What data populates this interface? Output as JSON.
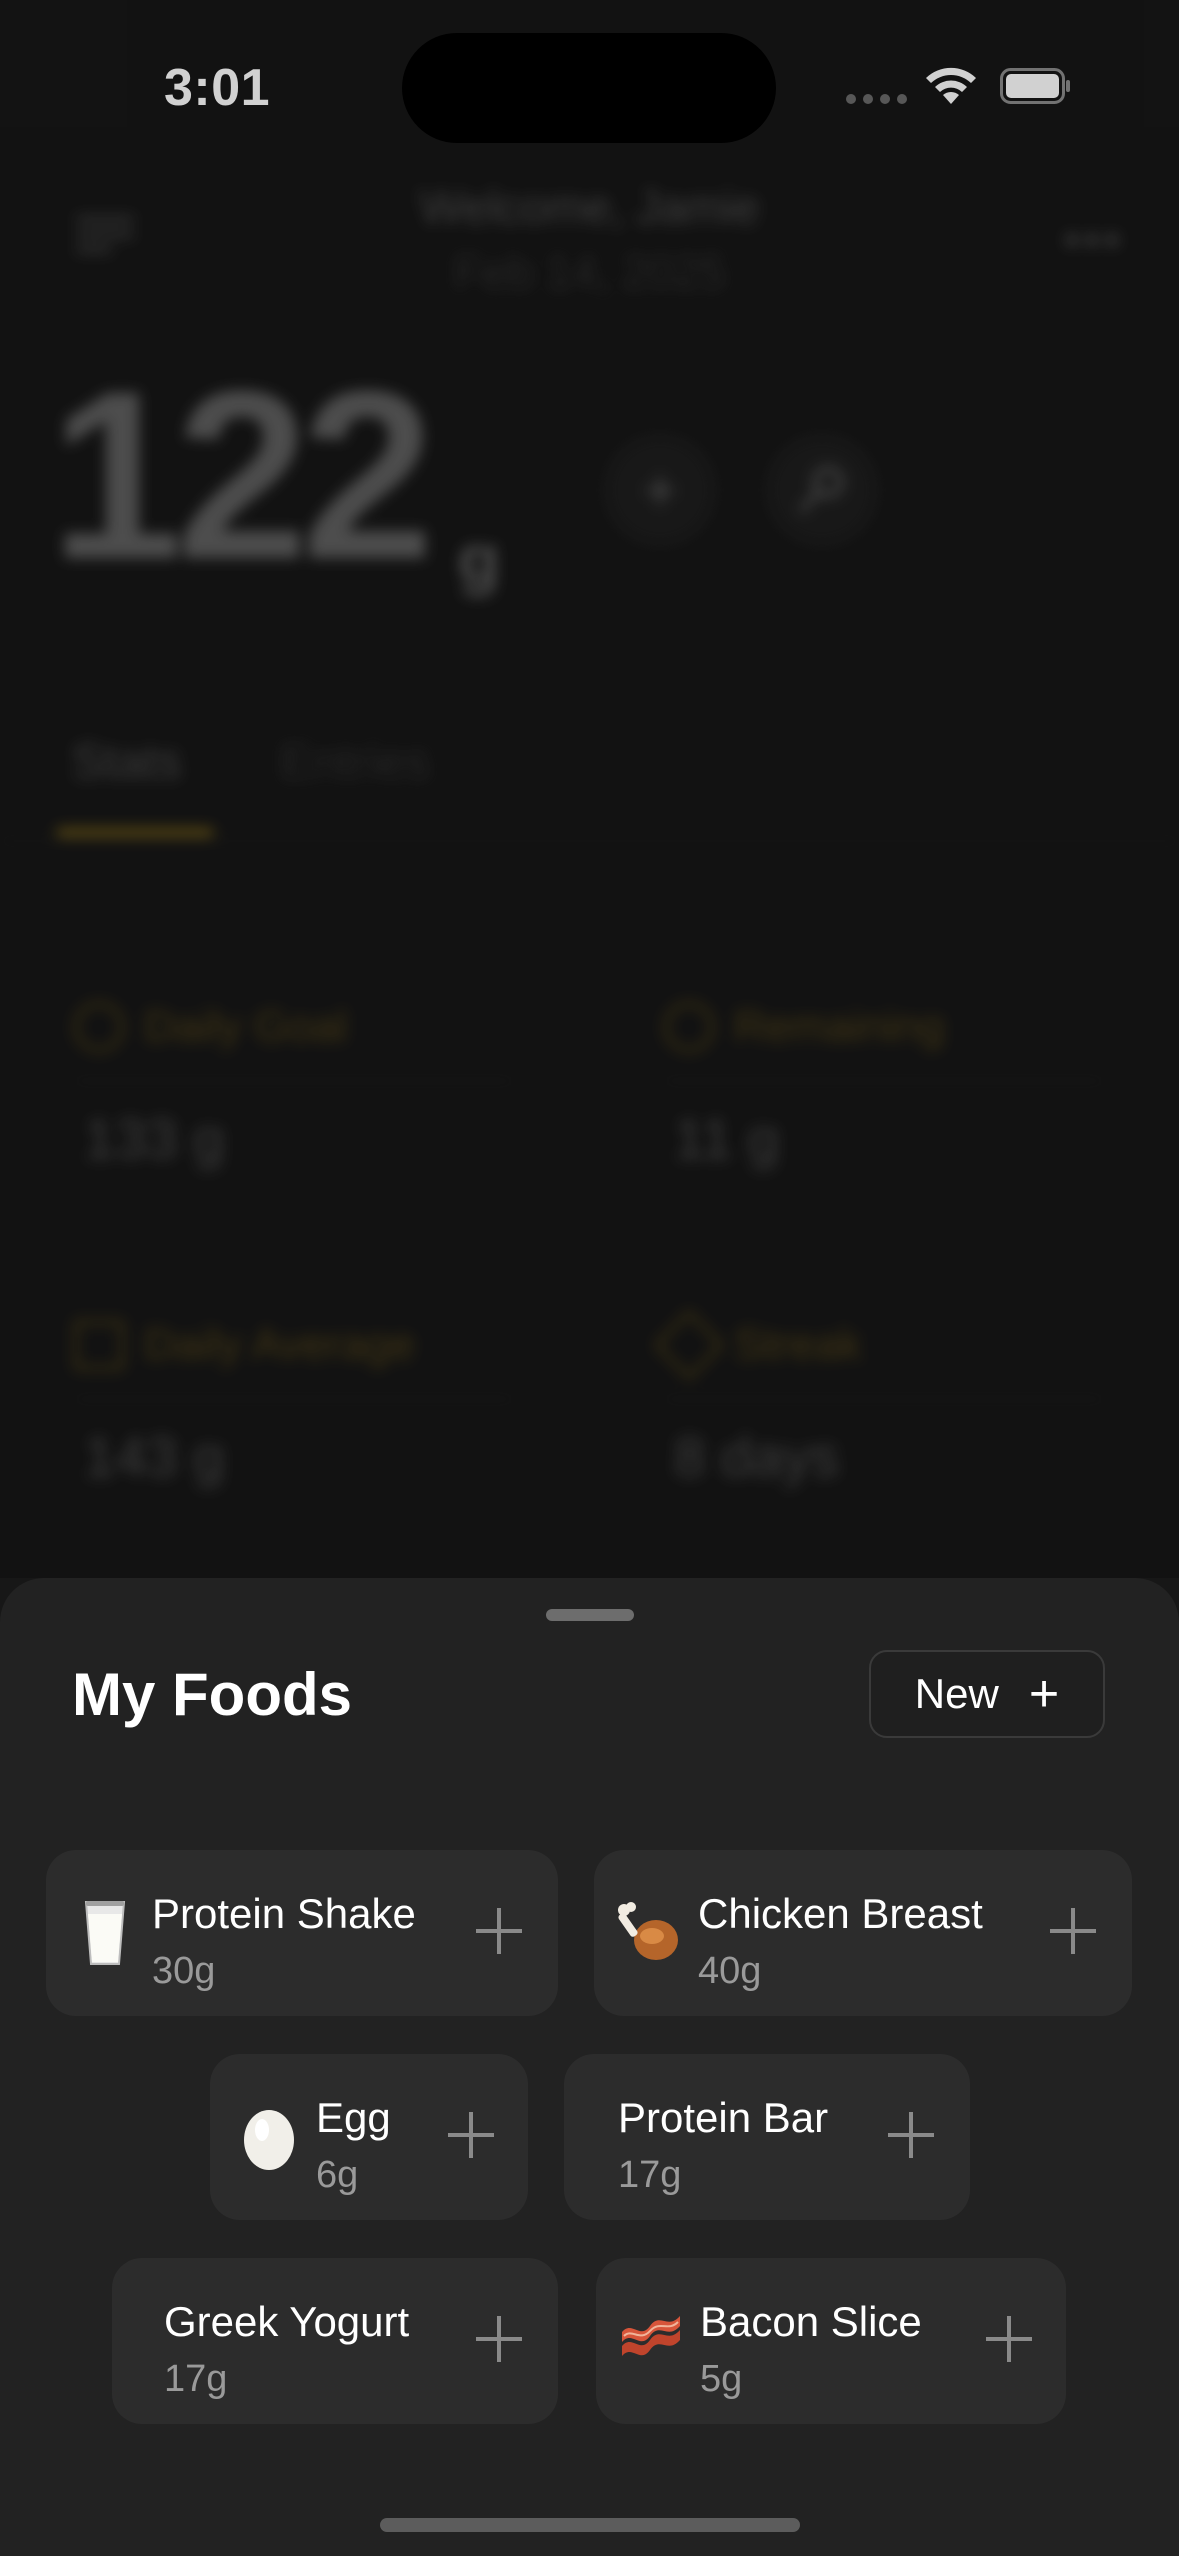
{
  "status_bar": {
    "time": "3:01"
  },
  "header": {
    "welcome": "Welcome, Jamie",
    "date": "Feb 14, 2025"
  },
  "today": {
    "total": "122",
    "unit": "g"
  },
  "tabs": [
    {
      "label": "Stats",
      "active": true
    },
    {
      "label": "Entries",
      "active": false
    }
  ],
  "stats": [
    {
      "label": "Daily Goal",
      "value": "133 g",
      "icon": "target-icon"
    },
    {
      "label": "Remaining",
      "value": "11 g",
      "icon": "pie-clock-icon"
    },
    {
      "label": "Daily Average",
      "value": "143 g",
      "icon": "bar-chart-icon"
    },
    {
      "label": "Streak",
      "value": "8 days",
      "icon": "bolt-icon"
    }
  ],
  "sheet": {
    "title": "My Foods",
    "new_label": "New",
    "foods": [
      {
        "name": "Protein Shake",
        "amount": "30g",
        "icon": "milk-glass-icon"
      },
      {
        "name": "Chicken Breast",
        "amount": "40g",
        "icon": "poultry-leg-icon"
      },
      {
        "name": "Egg",
        "amount": "6g",
        "icon": "egg-icon"
      },
      {
        "name": "Protein Bar",
        "amount": "17g",
        "icon": ""
      },
      {
        "name": "Greek Yogurt",
        "amount": "17g",
        "icon": ""
      },
      {
        "name": "Bacon Slice",
        "amount": "5g",
        "icon": "bacon-icon"
      }
    ]
  },
  "colors": {
    "background": "#171717",
    "sheet": "#222222",
    "card": "#2c2c2c",
    "accent": "#d4a017"
  }
}
